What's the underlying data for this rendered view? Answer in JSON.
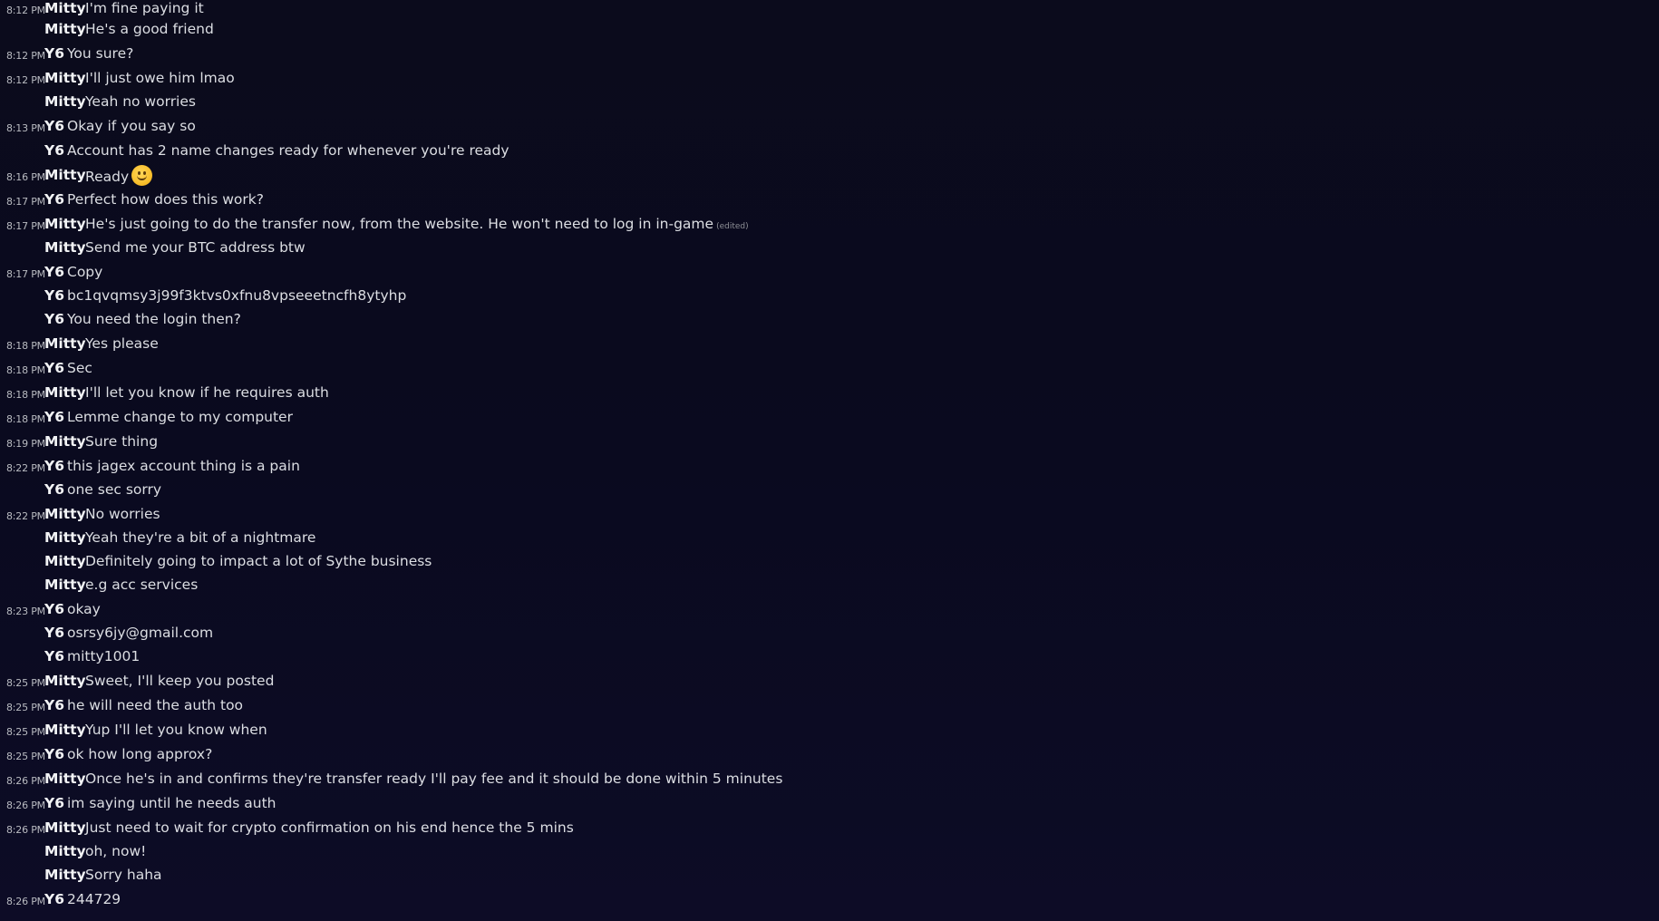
{
  "messages": [
    {
      "time": "8:12 PM",
      "author": "Mitty",
      "text": "I'm fine paying it"
    },
    {
      "time": "",
      "author": "Mitty",
      "text": "He's a good friend"
    },
    {
      "time": "8:12 PM",
      "author": "Y6",
      "text": "You sure?"
    },
    {
      "time": "8:12 PM",
      "author": "Mitty",
      "text": "I'll just owe him lmao"
    },
    {
      "time": "",
      "author": "Mitty",
      "text": "Yeah no worries"
    },
    {
      "time": "8:13 PM",
      "author": "Y6",
      "text": "Okay if you say so"
    },
    {
      "time": "",
      "author": "Y6",
      "text": "Account has 2 name changes ready for whenever you're ready"
    },
    {
      "time": "8:16 PM",
      "author": "Mitty",
      "text": "Ready",
      "emoji": "slightly-smiling-face-emoji"
    },
    {
      "time": "8:17 PM",
      "author": "Y6",
      "text": "Perfect how does this work?"
    },
    {
      "time": "8:17 PM",
      "author": "Mitty",
      "text": "He's just going to do the transfer now, from the website. He won't need to log in in-game",
      "edited": "(edited)"
    },
    {
      "time": "",
      "author": "Mitty",
      "text": "Send me your BTC address btw"
    },
    {
      "time": "8:17 PM",
      "author": "Y6",
      "text": "Copy"
    },
    {
      "time": "",
      "author": "Y6",
      "text": "bc1qvqmsy3j99f3ktvs0xfnu8vpseeetncfh8ytyhp"
    },
    {
      "time": "",
      "author": "Y6",
      "text": "You need the login then?"
    },
    {
      "time": "8:18 PM",
      "author": "Mitty",
      "text": "Yes please"
    },
    {
      "time": "8:18 PM",
      "author": "Y6",
      "text": "Sec"
    },
    {
      "time": "8:18 PM",
      "author": "Mitty",
      "text": "I'll let you know if he requires auth"
    },
    {
      "time": "8:18 PM",
      "author": "Y6",
      "text": "Lemme change to my computer"
    },
    {
      "time": "8:19 PM",
      "author": "Mitty",
      "text": "Sure thing"
    },
    {
      "time": "8:22 PM",
      "author": "Y6",
      "text": "this jagex account thing is a pain"
    },
    {
      "time": "",
      "author": "Y6",
      "text": "one sec sorry"
    },
    {
      "time": "8:22 PM",
      "author": "Mitty",
      "text": "No worries"
    },
    {
      "time": "",
      "author": "Mitty",
      "text": "Yeah they're a bit of a nightmare"
    },
    {
      "time": "",
      "author": "Mitty",
      "text": "Definitely going to impact a lot of Sythe business"
    },
    {
      "time": "",
      "author": "Mitty",
      "text": "e.g acc services"
    },
    {
      "time": "8:23 PM",
      "author": "Y6",
      "text": "okay"
    },
    {
      "time": "",
      "author": "Y6",
      "text": "osrsy6jy@gmail.com"
    },
    {
      "time": "",
      "author": "Y6",
      "text": "mitty1001"
    },
    {
      "time": "8:25 PM",
      "author": "Mitty",
      "text": "Sweet, I'll keep you posted"
    },
    {
      "time": "8:25 PM",
      "author": "Y6",
      "text": "he will need the auth too"
    },
    {
      "time": "8:25 PM",
      "author": "Mitty",
      "text": "Yup I'll let you know when"
    },
    {
      "time": "8:25 PM",
      "author": "Y6",
      "text": "ok how long approx?"
    },
    {
      "time": "8:26 PM",
      "author": "Mitty",
      "text": "Once he's in and confirms they're transfer ready I'll pay fee and it should be done within 5 minutes"
    },
    {
      "time": "8:26 PM",
      "author": "Y6",
      "text": "im saying until he needs auth"
    },
    {
      "time": "8:26 PM",
      "author": "Mitty",
      "text": "Just need to wait for crypto confirmation on his end hence the 5 mins"
    },
    {
      "time": "",
      "author": "Mitty",
      "text": "oh, now!"
    },
    {
      "time": "",
      "author": "Mitty",
      "text": "Sorry haha"
    },
    {
      "time": "8:26 PM",
      "author": "Y6",
      "text": "244729"
    }
  ]
}
